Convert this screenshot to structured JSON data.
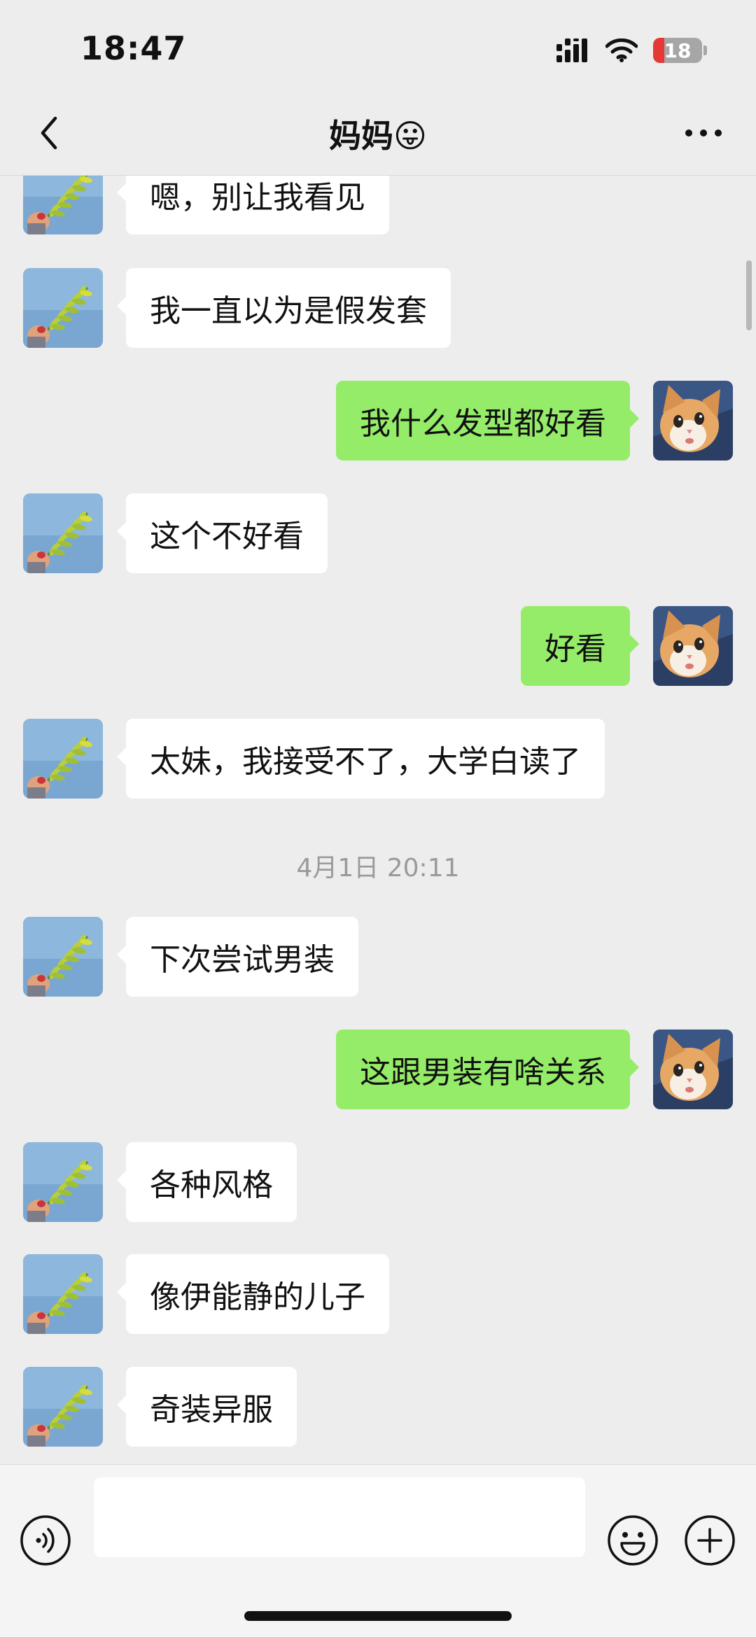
{
  "status_bar": {
    "time": "18:47",
    "battery": "18"
  },
  "header": {
    "title": "妈妈😛"
  },
  "messages": [
    {
      "text": "嗯，别让我看见"
    },
    {
      "text": "我一直以为是假发套"
    },
    {
      "text": "我什么发型都好看"
    },
    {
      "text": "这个不好看"
    },
    {
      "text": "好看"
    },
    {
      "text": "太妹，我接受不了，大学白读了"
    },
    {
      "text": "下次尝试男装"
    },
    {
      "text": "这跟男装有啥关系"
    },
    {
      "text": "各种风格"
    },
    {
      "text": "像伊能静的儿子"
    },
    {
      "text": "奇装异服"
    }
  ],
  "timestamp": "4月1日 20:11",
  "input": {
    "placeholder": ""
  },
  "icons": {
    "back": "chevron-left-icon",
    "more": "more-dots-icon",
    "voice": "voice-icon",
    "emoji": "emoji-icon",
    "plus": "plus-icon"
  },
  "colors": {
    "background": "#ededed",
    "outgoing_bubble": "#95ec69",
    "incoming_bubble": "#ffffff",
    "input_bar": "#f4f4f4"
  }
}
